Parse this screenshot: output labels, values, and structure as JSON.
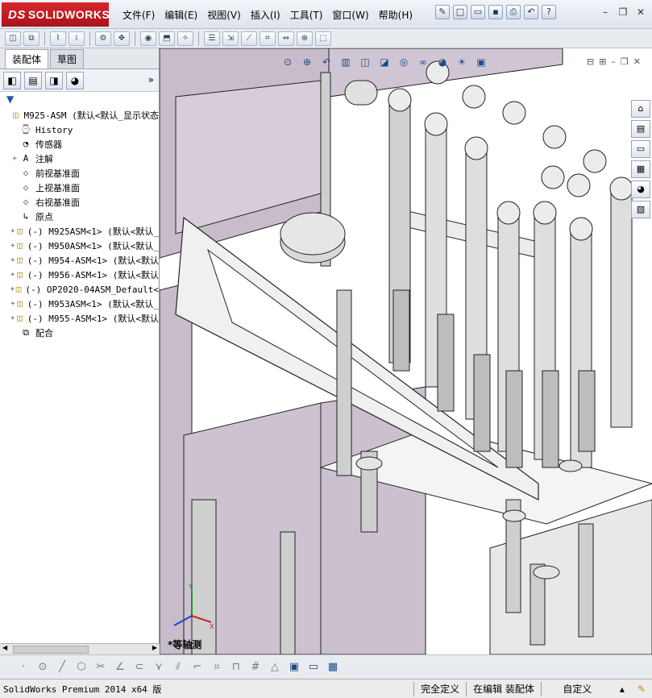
{
  "app": {
    "logo_prefix": "DS",
    "logo_text": "SOLIDWORKS"
  },
  "menu": [
    "文件(F)",
    "编辑(E)",
    "视图(V)",
    "插入(I)",
    "工具(T)",
    "窗口(W)",
    "帮助(H)"
  ],
  "left_panel": {
    "tabs": [
      "装配体",
      "草图"
    ],
    "active_tab": "装配体",
    "tree": [
      {
        "label": "M925-ASM  (默认<默认_显示状态",
        "icon": "assembly-icon",
        "expander": "",
        "indent": 0
      },
      {
        "label": "History",
        "icon": "history-icon",
        "expander": "",
        "indent": 1
      },
      {
        "label": "传感器",
        "icon": "sensor-icon",
        "expander": "",
        "indent": 1
      },
      {
        "label": "注解",
        "icon": "annotation-icon",
        "expander": "+",
        "indent": 1
      },
      {
        "label": "前视基准面",
        "icon": "plane-icon",
        "expander": "",
        "indent": 1
      },
      {
        "label": "上视基准面",
        "icon": "plane-icon",
        "expander": "",
        "indent": 1
      },
      {
        "label": "右视基准面",
        "icon": "plane-icon",
        "expander": "",
        "indent": 1
      },
      {
        "label": "原点",
        "icon": "origin-icon",
        "expander": "",
        "indent": 1
      },
      {
        "label": "(-) M925ASM<1> (默认<默认_",
        "icon": "subassembly-icon",
        "expander": "+",
        "indent": 1
      },
      {
        "label": "(-) M950ASM<1> (默认<默认_",
        "icon": "subassembly-icon",
        "expander": "+",
        "indent": 1
      },
      {
        "label": "(-) M954-ASM<1> (默认<默认",
        "icon": "subassembly-icon",
        "expander": "+",
        "indent": 1
      },
      {
        "label": "(-) M956-ASM<1> (默认<默认",
        "icon": "subassembly-icon",
        "expander": "+",
        "indent": 1
      },
      {
        "label": "(-) OP2020-04ASM_Default<",
        "icon": "subassembly-icon",
        "expander": "+",
        "indent": 1
      },
      {
        "label": "(-) M953ASM<1> (默认<默认_",
        "icon": "subassembly-icon",
        "expander": "+",
        "indent": 1
      },
      {
        "label": "(-) M955-ASM<1> (默认<默认",
        "icon": "subassembly-icon",
        "expander": "+",
        "indent": 1
      },
      {
        "label": "配合",
        "icon": "mates-icon",
        "expander": "",
        "indent": 1
      }
    ]
  },
  "viewport": {
    "view_label": "*等轴测"
  },
  "status": {
    "version": "SolidWorks Premium 2014 x64 版",
    "definition": "完全定义",
    "editing": "在编辑 装配体",
    "units": "自定义"
  },
  "colors": {
    "logo_red": "#c41e24",
    "model_purple": "#c8bccb",
    "model_gray": "#dcdcdc"
  }
}
